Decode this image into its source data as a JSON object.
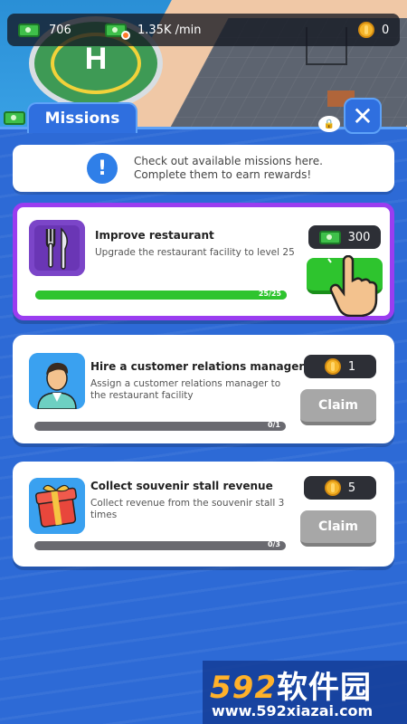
{
  "hud": {
    "cash": "706",
    "income_rate": "1.35K /min",
    "coins": "0"
  },
  "panel": {
    "tab_title": "Missions",
    "close_symbol": "✕",
    "info_line1": "Check out available missions here.",
    "info_line2": "Complete them to earn rewards!",
    "info_symbol": "!"
  },
  "missions": [
    {
      "title": "Improve restaurant",
      "description": "Upgrade the restaurant facility to level 25",
      "reward_type": "cash",
      "reward": "300",
      "progress": 1.0,
      "progress_text": "25/25",
      "claim_label": "",
      "state": "active",
      "icon": "fork-knife-icon"
    },
    {
      "title": "Hire a customer relations manager",
      "description": "Assign a customer relations manager to the restaurant facility",
      "reward_type": "coin",
      "reward": "1",
      "progress": 0.0,
      "progress_text": "0/1",
      "claim_label": "Claim",
      "state": "locked",
      "icon": "manager-avatar-icon"
    },
    {
      "title": "Collect souvenir stall revenue",
      "description": "Collect revenue from the souvenir stall 3 times",
      "reward_type": "coin",
      "reward": "5",
      "progress": 0.0,
      "progress_text": "0/3",
      "claim_label": "Claim",
      "state": "locked",
      "icon": "gift-box-icon"
    }
  ],
  "watermark": {
    "logo_num": "592",
    "logo_text": "软件园",
    "url": "www.592xiazai.com"
  },
  "colors": {
    "panel_blue": "#2d6ad6",
    "active_border": "#9a3df0",
    "claim_green": "#2ec42e",
    "claim_gray": "#a7a7a7"
  }
}
